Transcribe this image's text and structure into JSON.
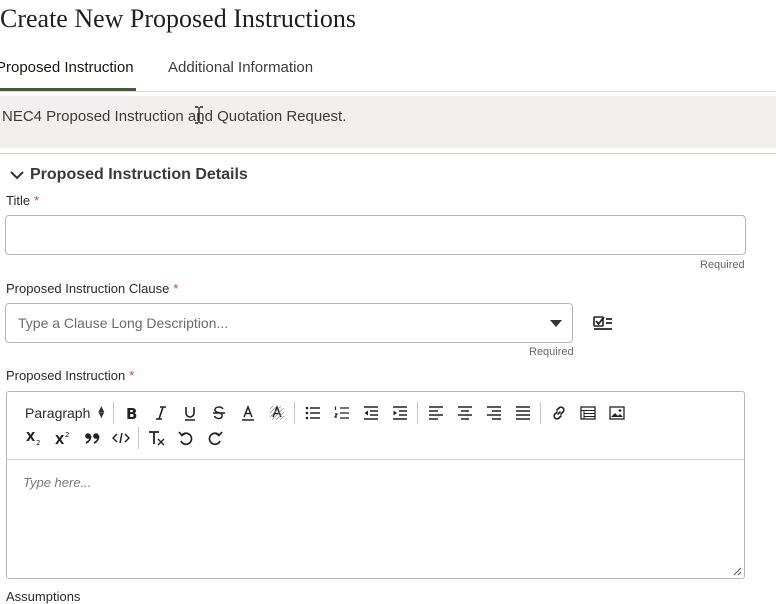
{
  "page": {
    "title": "Create New Proposed Instructions"
  },
  "tabs": [
    {
      "label": "Proposed Instruction",
      "active": true
    },
    {
      "label": "Additional Information",
      "active": false
    }
  ],
  "banner": {
    "text": "NEC4 Proposed Instruction and Quotation Request."
  },
  "section": {
    "title": "Proposed Instruction Details",
    "expanded": true
  },
  "fields": {
    "title": {
      "label": "Title",
      "required_marker": "*",
      "value": "",
      "hint": "Required"
    },
    "clause": {
      "label": "Proposed Instruction Clause",
      "required_marker": "*",
      "placeholder": "Type a Clause Long Description...",
      "hint": "Required",
      "side_icon": "checklist-icon"
    },
    "instruction": {
      "label": "Proposed Instruction",
      "required_marker": "*",
      "placeholder": "Type here...",
      "paragraph_label": "Paragraph"
    },
    "assumptions": {
      "label": "Assumptions"
    }
  },
  "toolbar_icons": [
    "bold-icon",
    "italic-icon",
    "underline-icon",
    "strikethrough-icon",
    "font-color-icon",
    "highlight-icon",
    "bullet-list-icon",
    "numbered-list-icon",
    "outdent-icon",
    "indent-icon",
    "align-left-icon",
    "align-center-icon",
    "align-right-icon",
    "justify-icon",
    "link-icon",
    "table-icon",
    "image-icon",
    "subscript-icon",
    "superscript-icon",
    "blockquote-icon",
    "code-icon",
    "clear-formatting-icon",
    "undo-icon",
    "redo-icon"
  ],
  "colors": {
    "accent": "#3f5c39",
    "required": "#c74634",
    "banner_bg": "#f1efed"
  }
}
